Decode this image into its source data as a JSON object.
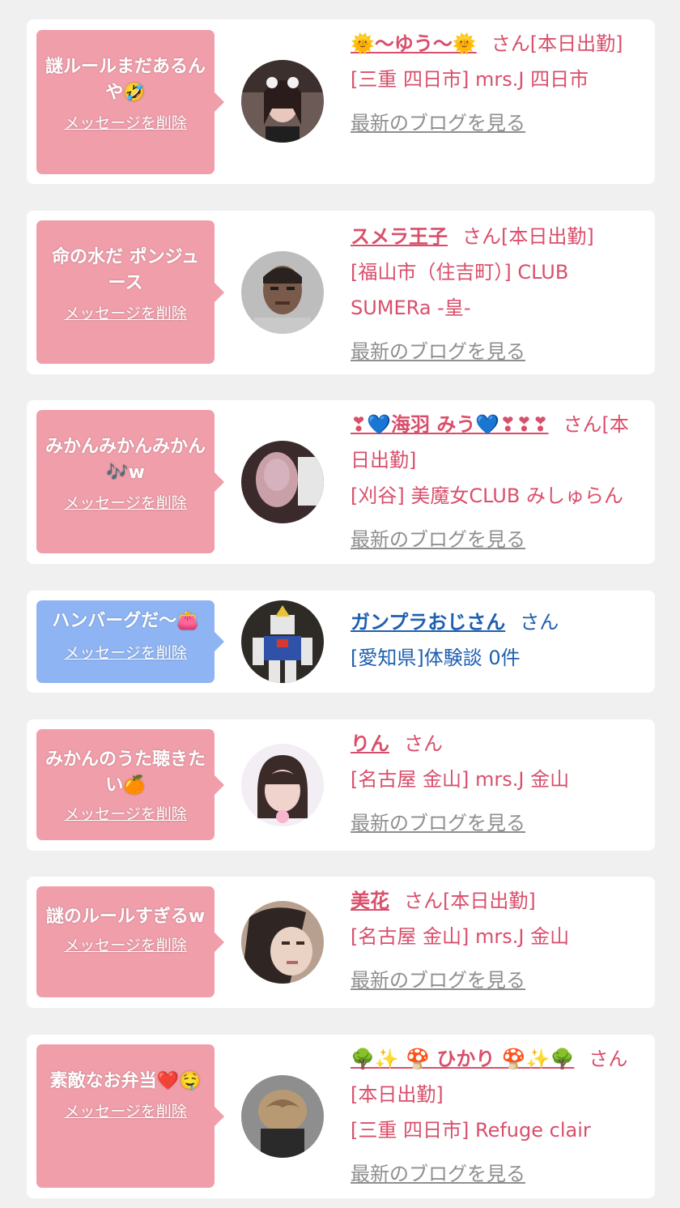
{
  "colors": {
    "page_bg": "#f0f0f0",
    "card_bg": "#ffffff",
    "bubble_pink": "#ef9eaa",
    "bubble_blue": "#8fb4f3",
    "text_pink": "#d94f6b",
    "text_blue": "#1f5fb0",
    "link_gray": "#8f8f8f"
  },
  "cards": [
    {
      "message": "謎ルールまだあるんや🤣",
      "delete_label": "メッセージを削除",
      "name": "🌞〜ゆう〜🌞",
      "suffix": "さん[本日出勤]",
      "shop": "[三重 四日市] mrs.J 四日市",
      "blog_label": "最新のブログを見る",
      "bubble_color": "pink",
      "avatar_icon": "woman-cat-filter-avatar"
    },
    {
      "message": "命の水だ ポンジュース",
      "delete_label": "メッセージを削除",
      "name": "スメラ王子",
      "suffix": "さん[本日出勤]",
      "shop": "[福山市（住吉町）] CLUB SUMERa -皇-",
      "blog_label": "最新のブログを見る",
      "bubble_color": "pink",
      "avatar_icon": "man-face-avatar"
    },
    {
      "message": "みかんみかんみかん🎶w",
      "delete_label": "メッセージを削除",
      "name": "❣💙海羽 みう💙❣❣❣",
      "suffix": "さん[本日出勤]",
      "shop": "[刈谷] 美魔女CLUB みしゅらん",
      "blog_label": "最新のブログを見る",
      "bubble_color": "pink",
      "avatar_icon": "blurred-woman-avatar"
    },
    {
      "message": "ハンバーグだ〜👛",
      "delete_label": "メッセージを削除",
      "name": "ガンプラおじさん",
      "suffix": "さん",
      "shop": "[愛知県]体験談 0件",
      "blog_label": "",
      "bubble_color": "blue",
      "avatar_icon": "robot-model-avatar"
    },
    {
      "message": "みかんのうた聴きたい🍊",
      "delete_label": "メッセージを削除",
      "name": "りん",
      "suffix": "さん",
      "shop": "[名古屋 金山] mrs.J 金山",
      "blog_label": "最新のブログを見る",
      "bubble_color": "pink",
      "avatar_icon": "woman-bangs-avatar"
    },
    {
      "message": "謎のルールすぎるw",
      "delete_label": "メッセージを削除",
      "name": "美花",
      "suffix": "さん[本日出勤]",
      "shop": "[名古屋 金山] mrs.J 金山",
      "blog_label": "最新のブログを見る",
      "bubble_color": "pink",
      "avatar_icon": "woman-closeup-avatar"
    },
    {
      "message": "素敵なお弁当❤️🤤",
      "delete_label": "メッセージを削除",
      "name": "🌳✨ 🍄 ひかり 🍄✨🌳",
      "suffix": "さん[本日出勤]",
      "shop": "[三重 四日市] Refuge clair",
      "blog_label": "最新のブログを見る",
      "bubble_color": "pink",
      "avatar_icon": "hair-back-avatar"
    }
  ]
}
